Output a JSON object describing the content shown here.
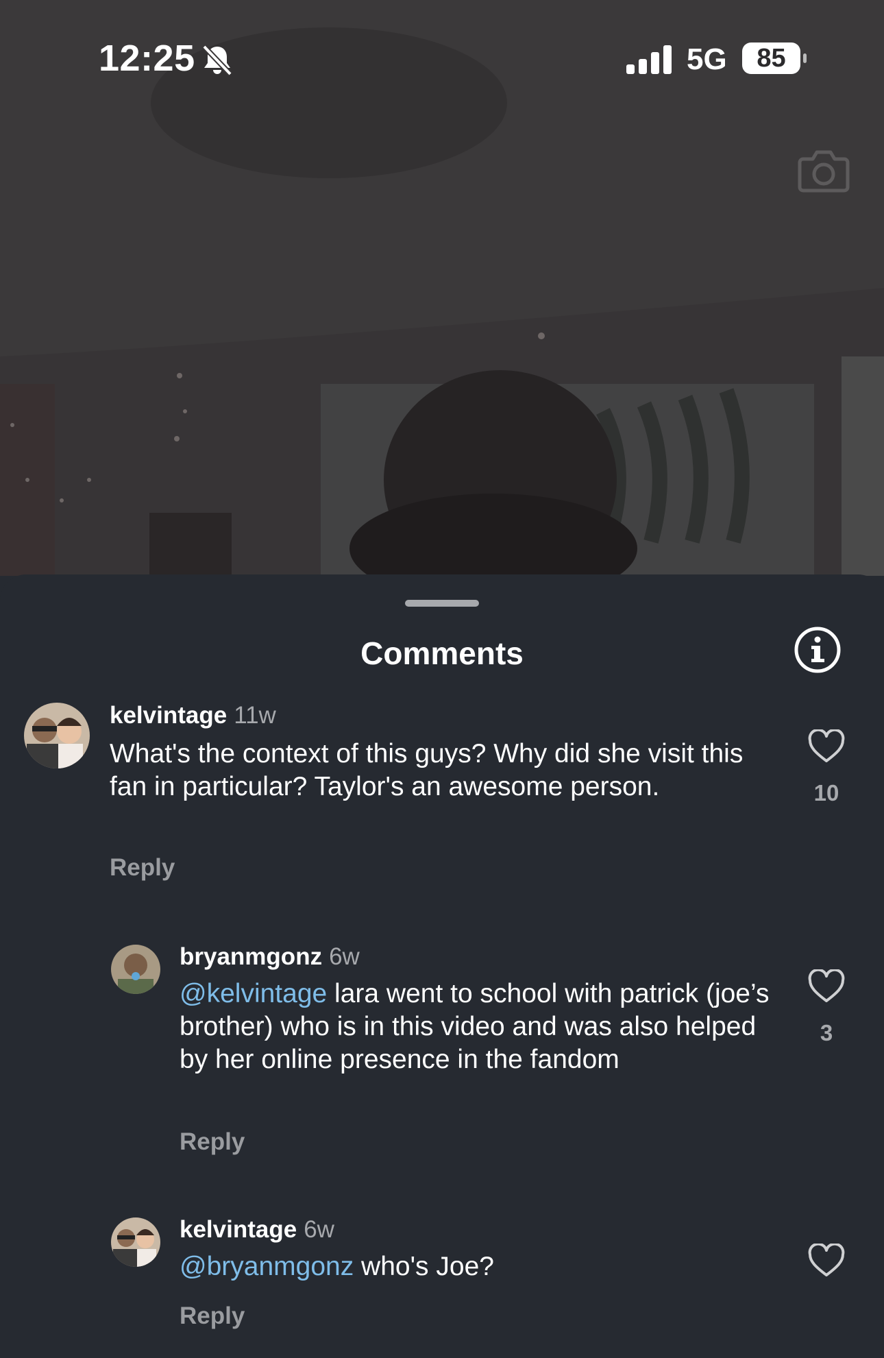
{
  "status_bar": {
    "time": "12:25",
    "network": "5G",
    "battery": "85"
  },
  "sheet": {
    "title": "Comments"
  },
  "comments": [
    {
      "username": "kelvintage",
      "age": "11w",
      "text": "What's the context of this guys? Why did she visit this fan in particular? Taylor's an awesome person.",
      "reply_label": "Reply",
      "likes": "10"
    },
    {
      "username": "bryanmgonz",
      "age": "6w",
      "mention": "@kelvintage",
      "text": " lara went to school with patrick (joe’s brother) who is in this video and was also helped by her online presence in the fandom",
      "reply_label": "Reply",
      "likes": "3"
    },
    {
      "username": "kelvintage",
      "age": "6w",
      "mention": "@bryanmgonz",
      "text": " who's Joe?",
      "reply_label": "Reply"
    }
  ],
  "colors": {
    "sheet_bg": "#262a31",
    "mention": "#7fbde9",
    "muted": "#a7a9ad"
  }
}
